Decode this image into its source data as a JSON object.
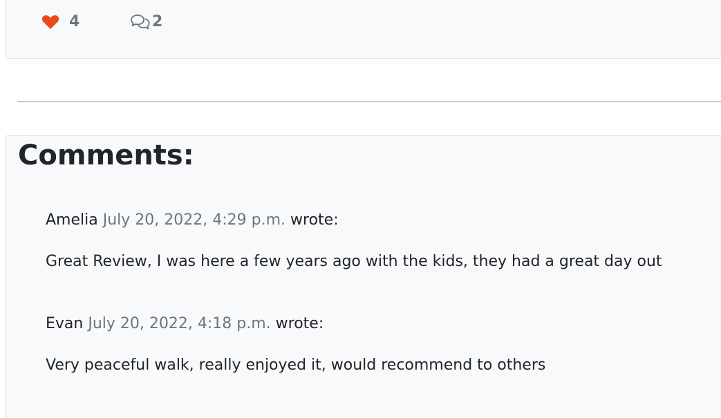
{
  "post_footer": {
    "likes_count": "4",
    "comments_count": "2",
    "like_icon": "heart-icon",
    "comment_icon": "chat-bubbles-icon",
    "like_color": "#e8491d"
  },
  "comments_section": {
    "heading": "Comments:",
    "comments": [
      {
        "author": "Amelia",
        "date": "July 20, 2022, 4:29 p.m.",
        "wrote": "wrote:",
        "body": "Great Review, I was here a few years ago with the kids, they had a great day out"
      },
      {
        "author": "Evan",
        "date": "July 20, 2022, 4:18 p.m.",
        "wrote": "wrote:",
        "body": "Very peaceful walk, really enjoyed it, would recommend to others"
      }
    ]
  }
}
